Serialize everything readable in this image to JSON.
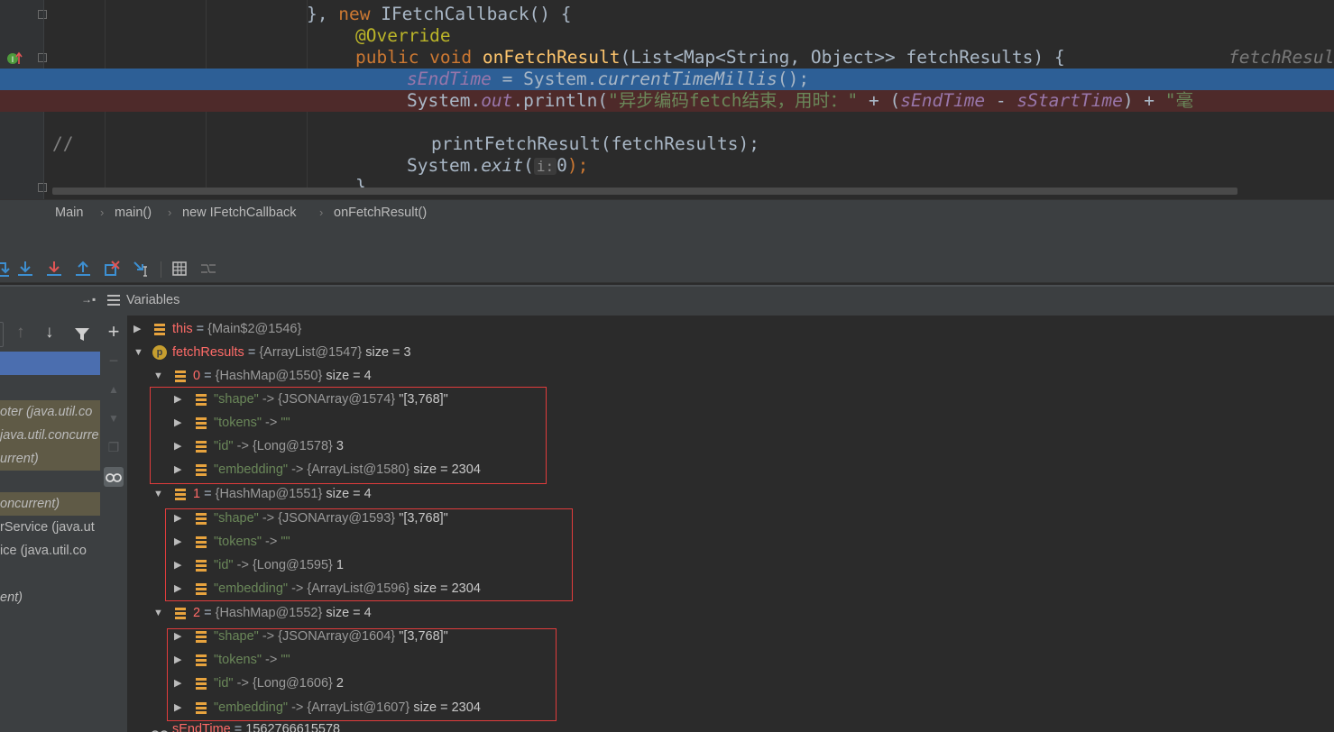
{
  "editor": {
    "lines": {
      "l1": {
        "pre": "}, ",
        "kw": "new ",
        "rest": "IFetchCallback() {"
      },
      "l2": {
        "ann": "@Override"
      },
      "l3": {
        "kw": "public void ",
        "fn": "onFetchResult",
        "rest": "(List<Map<String, Object>> fetchResults) {",
        "hint": "fetchResul"
      },
      "l4": {
        "field": "sEndTime",
        "mid": " = System.",
        "italic": "currentTimeMillis",
        "end": "();"
      },
      "l5": {
        "pre": "System.",
        "field": "out",
        "mid": ".println(",
        "str": "\"异步编码fetch结束，用时：\"",
        "plus": " + (",
        "f1": "sEndTime",
        "minus": " - ",
        "f2": "sStartTime",
        "close": ") + ",
        "str2": "\"毫"
      },
      "l7": {
        "cmt": "//",
        "code": "printFetchResult(fetchResults);"
      },
      "l8": {
        "pre": "System.",
        "italic": "exit",
        "open": "(",
        "hint": "i:",
        "arg": "0",
        "close": ");"
      },
      "l9": {
        "brace": "}"
      }
    }
  },
  "breadcrumb": [
    "Main",
    "main()",
    "new IFetchCallback",
    "onFetchResult()"
  ],
  "panels": {
    "variables_title": "Variables"
  },
  "frames": [
    "oter (java.util.co",
    "java.util.concurre",
    "urrent)",
    "oncurrent)",
    "rService (java.ut",
    "ice (java.util.co",
    "ent)"
  ],
  "variables": {
    "this": {
      "name": "this",
      "eq": " = ",
      "val": "{Main$2@1546}"
    },
    "fetchResults": {
      "name": "fetchResults",
      "eq": " = ",
      "val": "{ArrayList@1547}",
      "extra": "size = 3",
      "icon": "p"
    },
    "items": [
      {
        "name": "0",
        "val": "{HashMap@1550}",
        "extra": "size = 4",
        "entries": [
          {
            "key": "\"shape\"",
            "arrow": "->",
            "val": "{JSONArray@1574}",
            "extra": "\"[3,768]\""
          },
          {
            "key": "\"tokens\"",
            "arrow": "->",
            "val": "\"\"",
            "extra": ""
          },
          {
            "key": "\"id\"",
            "arrow": "->",
            "val": "{Long@1578}",
            "extra": "3"
          },
          {
            "key": "\"embedding\"",
            "arrow": "->",
            "val": "{ArrayList@1580}",
            "extra": "size = 2304"
          }
        ]
      },
      {
        "name": "1",
        "val": "{HashMap@1551}",
        "extra": "size = 4",
        "entries": [
          {
            "key": "\"shape\"",
            "arrow": "->",
            "val": "{JSONArray@1593}",
            "extra": "\"[3,768]\""
          },
          {
            "key": "\"tokens\"",
            "arrow": "->",
            "val": "\"\"",
            "extra": ""
          },
          {
            "key": "\"id\"",
            "arrow": "->",
            "val": "{Long@1595}",
            "extra": "1"
          },
          {
            "key": "\"embedding\"",
            "arrow": "->",
            "val": "{ArrayList@1596}",
            "extra": "size = 2304"
          }
        ]
      },
      {
        "name": "2",
        "val": "{HashMap@1552}",
        "extra": "size = 4",
        "entries": [
          {
            "key": "\"shape\"",
            "arrow": "->",
            "val": "{JSONArray@1604}",
            "extra": "\"[3,768]\""
          },
          {
            "key": "\"tokens\"",
            "arrow": "->",
            "val": "\"\"",
            "extra": ""
          },
          {
            "key": "\"id\"",
            "arrow": "->",
            "val": "{Long@1606}",
            "extra": "2"
          },
          {
            "key": "\"embedding\"",
            "arrow": "->",
            "val": "{ArrayList@1607}",
            "extra": "size = 2304"
          }
        ]
      }
    ],
    "sEndTime": {
      "name": "sEndTime",
      "eq": " = ",
      "val": "1562766615578"
    }
  },
  "colors": {
    "editor_bg": "#2b2b2b",
    "current_line": "#2d5f96",
    "breakpoint_line": "#4e2a2a",
    "annotation_box": "#e03c3c",
    "panel_bg": "#3c3f41"
  },
  "icons": [
    "breakpoint-icon",
    "step-over-icon",
    "step-into-icon",
    "force-step-into-icon",
    "step-out-icon",
    "drop-frame-icon",
    "run-to-cursor-icon",
    "evaluate-expression-icon",
    "trace-icon",
    "add-watch-icon",
    "filter-icon",
    "glasses-icon"
  ]
}
